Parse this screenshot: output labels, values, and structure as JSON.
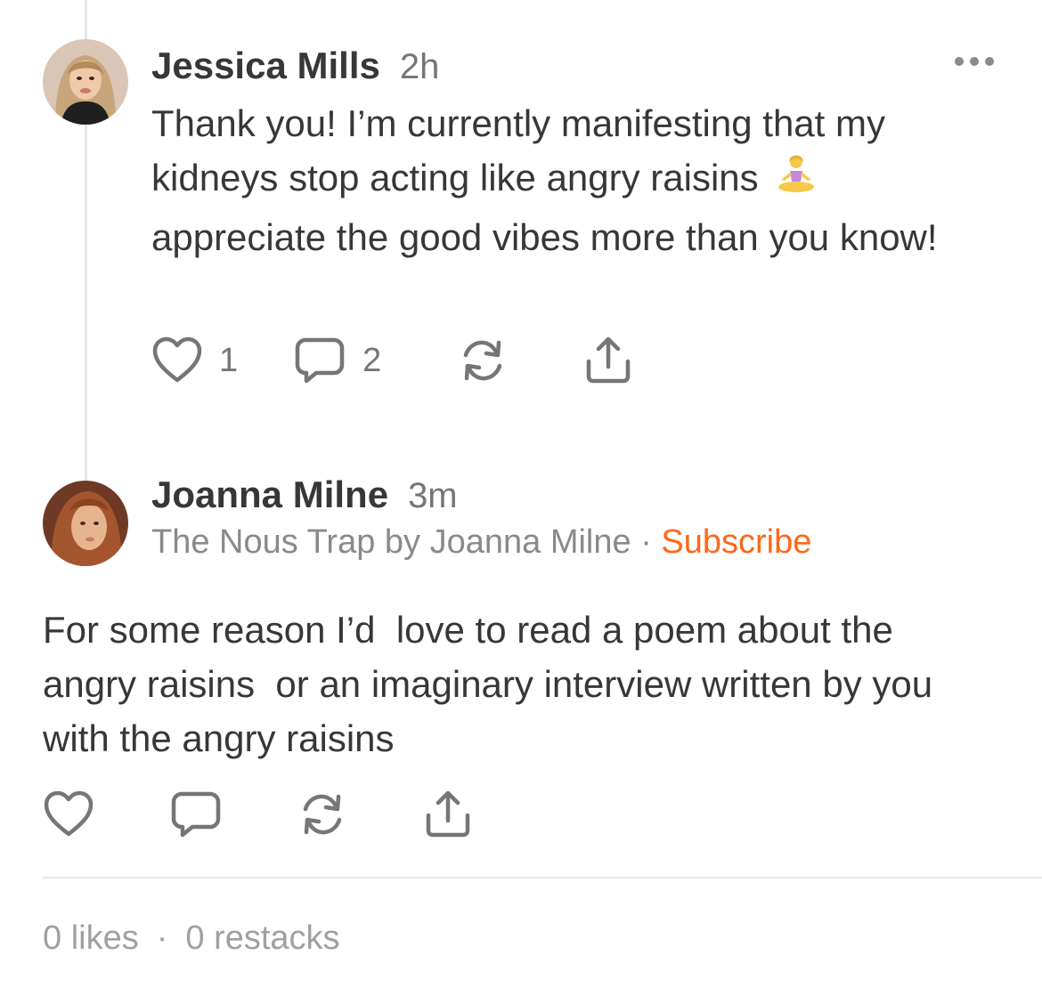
{
  "comment1": {
    "author": "Jessica Mills",
    "time": "2h",
    "text_before_emoji": "Thank you! I’m currently manifesting that my kidneys stop acting like angry raisins",
    "emoji": "woman-in-lotus-position-icon",
    "text_after_emoji": "appreciate the good vibes more than you know!",
    "likes": "1",
    "comments": "2"
  },
  "comment2": {
    "author": "Joanna Milne",
    "time": "3m",
    "publication": "The Nous Trap by Joanna Milne",
    "separator": "·",
    "subscribe_label": "Subscribe",
    "text": "For some reason I’d  love to read a poem about the angry raisins  or an imaginary interview written by you  with the angry raisins"
  },
  "footer": {
    "likes": "0 likes",
    "separator": "·",
    "restacks": "0 restacks"
  },
  "colors": {
    "text": "#363737",
    "muted": "#767676",
    "accent": "#ff6719",
    "divider": "#e6e6e6"
  }
}
